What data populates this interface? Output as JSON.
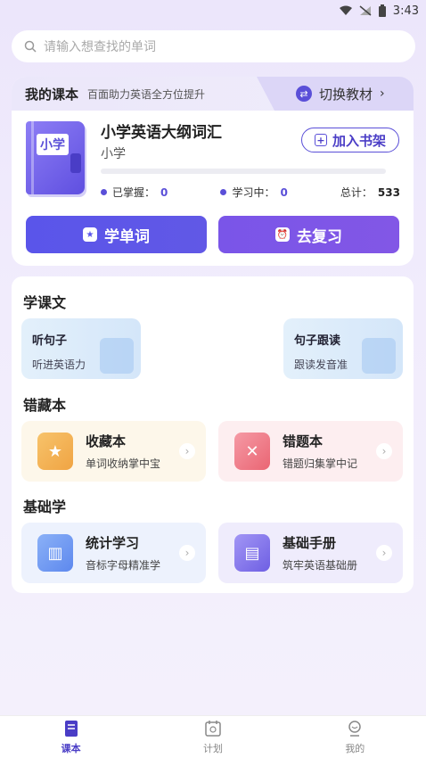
{
  "status_bar": {
    "time": "3:43"
  },
  "search": {
    "placeholder": "请输入想查找的单词"
  },
  "course": {
    "header_title": "我的课本",
    "header_slogan": "百面助力英语全方位提升",
    "switch_label": "切换教材",
    "cover_label": "小学",
    "name": "小学英语大纲词汇",
    "level": "小学",
    "add_shelf_label": "加入书架",
    "mastered_label": "已掌握：",
    "mastered_value": "0",
    "learning_label": "学习中：",
    "learning_value": "0",
    "total_label": "总计：",
    "total_value": "533",
    "progress": 0,
    "learn_btn": "学单词",
    "review_btn": "去复习"
  },
  "sections": {
    "lessons_title": "学课文",
    "lessons": [
      {
        "title": "听句子",
        "subtitle": "听进英语力"
      },
      {
        "title": "句子跟读",
        "subtitle": "跟读发音准"
      }
    ],
    "wrongbook_title": "错藏本",
    "wrongbook": [
      {
        "title": "收藏本",
        "subtitle": "单词收纳掌中宝",
        "icon": "star-book-icon"
      },
      {
        "title": "错题本",
        "subtitle": "错题归集掌中记",
        "icon": "x-book-icon"
      }
    ],
    "basics_title": "基础学",
    "basics": [
      {
        "title": "统计学习",
        "subtitle": "音标字母精准学",
        "icon": "chart-icon"
      },
      {
        "title": "基础手册",
        "subtitle": "筑牢英语基础册",
        "icon": "manual-icon"
      }
    ]
  },
  "nav": [
    {
      "label": "课本",
      "active": true
    },
    {
      "label": "计划",
      "active": false
    },
    {
      "label": "我的",
      "active": false
    }
  ],
  "colors": {
    "accent": "#5a4fd8",
    "review": "#7f56e6"
  }
}
